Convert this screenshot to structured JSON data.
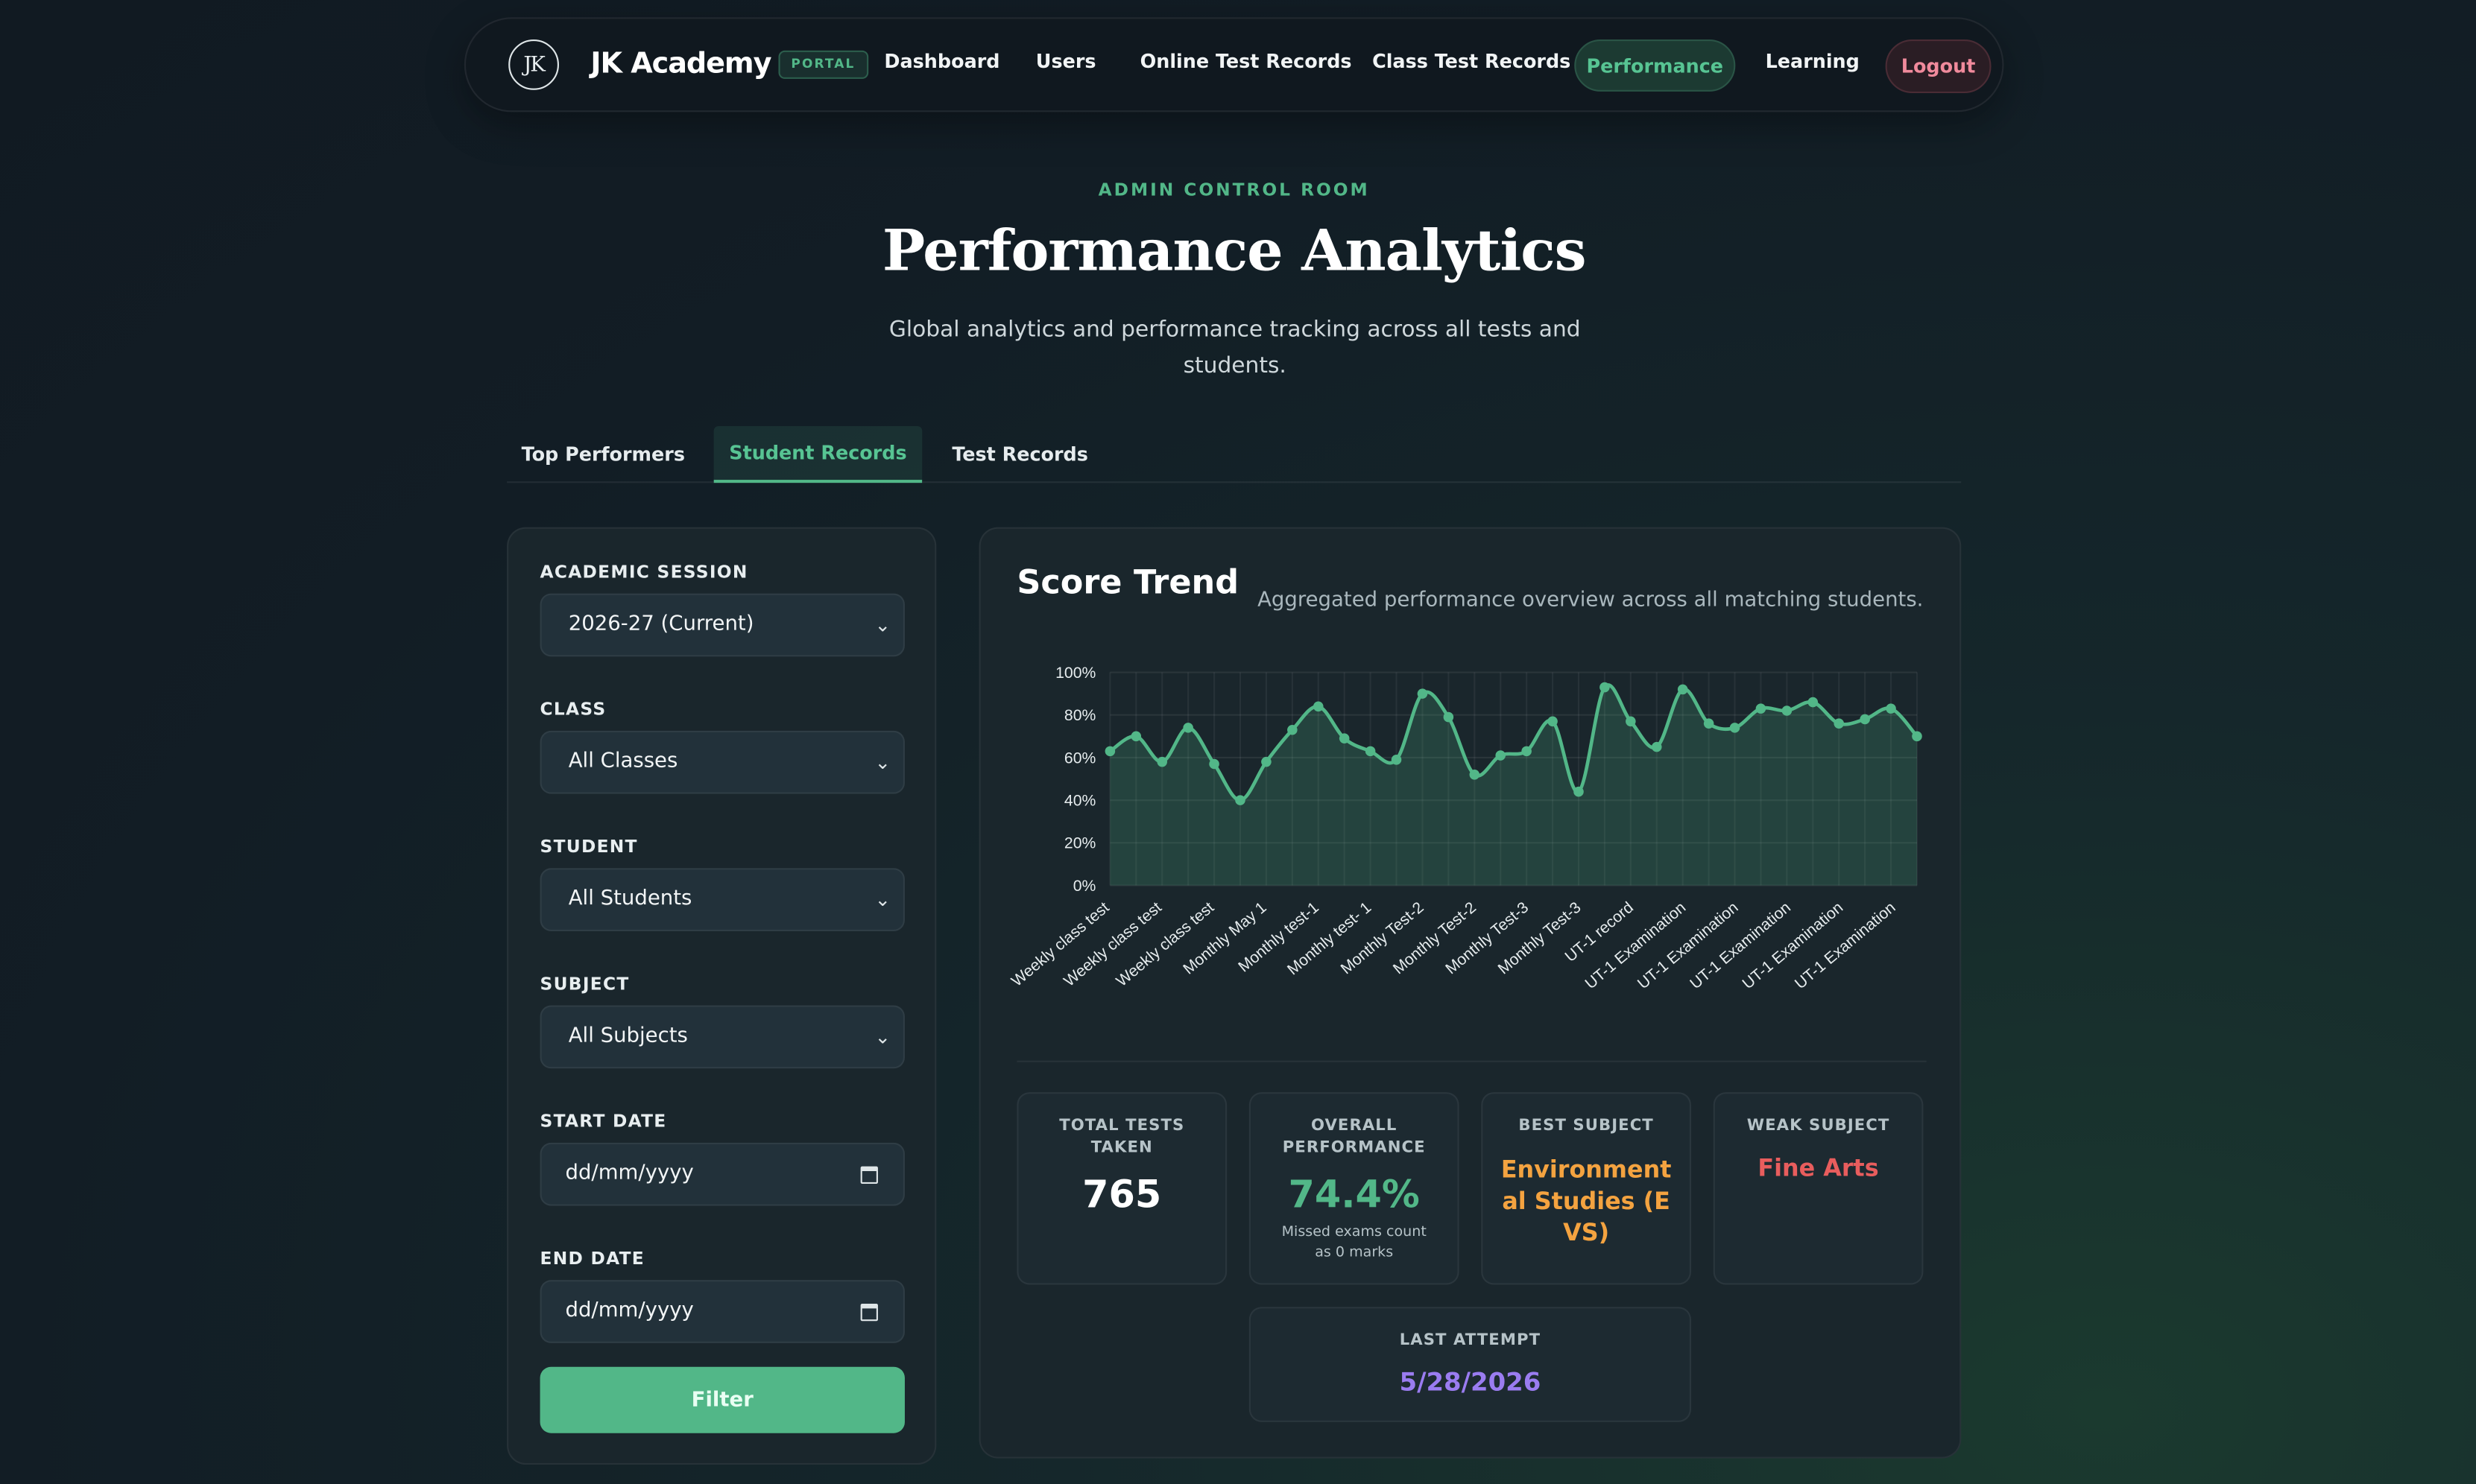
{
  "nav": {
    "logo_text": "JK",
    "brand": "JK Academy",
    "badge": "PORTAL",
    "links": [
      "Dashboard",
      "Users",
      "Online Test Records",
      "Class Test Records",
      "Performance",
      "Learning"
    ],
    "logout": "Logout"
  },
  "header": {
    "eyebrow": "ADMIN CONTROL ROOM",
    "title": "Performance Analytics",
    "subtitle": "Global analytics and performance tracking across all tests and students."
  },
  "tabs": [
    {
      "label": "Top Performers",
      "active": false
    },
    {
      "label": "Student Records",
      "active": true
    },
    {
      "label": "Test Records",
      "active": false
    }
  ],
  "filters": {
    "session": {
      "label": "ACADEMIC SESSION",
      "value": "2026-27 (Current)"
    },
    "class": {
      "label": "CLASS",
      "value": "All Classes"
    },
    "student": {
      "label": "STUDENT",
      "value": "All Students"
    },
    "subject": {
      "label": "SUBJECT",
      "value": "All Subjects"
    },
    "start_date": {
      "label": "START DATE",
      "placeholder": "dd/mm/yyyy"
    },
    "end_date": {
      "label": "END DATE",
      "placeholder": "dd/mm/yyyy"
    },
    "button": "Filter"
  },
  "score_trend": {
    "title": "Score Trend",
    "subtitle": "Aggregated performance overview across all matching students."
  },
  "stats": {
    "total_tests": {
      "label": "TOTAL TESTS TAKEN",
      "value": "765"
    },
    "overall": {
      "label": "OVERALL PERFORMANCE",
      "value": "74.4%",
      "note": "Missed exams count as 0 marks"
    },
    "best_subject": {
      "label": "BEST SUBJECT",
      "value": "Environmental Studies (EVS)"
    },
    "weak_subject": {
      "label": "WEAK SUBJECT",
      "value": "Fine Arts"
    },
    "last_attempt": {
      "label": "LAST ATTEMPT",
      "value": "5/28/2026"
    }
  },
  "colors": {
    "accent": "#52b788",
    "best": "#f4a340",
    "weak": "#e85d5d",
    "last_attempt": "#9a7cf0"
  },
  "chart_data": {
    "type": "area",
    "ylim": [
      0,
      100
    ],
    "y_ticks": [
      "0%",
      "20%",
      "40%",
      "60%",
      "80%",
      "100%"
    ],
    "x_tick_labels": [
      "Weekly class test",
      "Weekly class test",
      "Weekly class test",
      "Monthly May 1",
      "Monthly test-1",
      "Monthly test- 1",
      "Monthly Test-2",
      "Monthly Test-2",
      "Monthly Test-3",
      "Monthly Test-3",
      "UT-1 record",
      "UT-1 Examination",
      "UT-1 Examination",
      "UT-1 Examination",
      "UT-1 Examination",
      "UT-1 Examination"
    ],
    "values": [
      63,
      70,
      58,
      74,
      57,
      40,
      58,
      73,
      84,
      69,
      63,
      59,
      90,
      79,
      52,
      61,
      63,
      77,
      44,
      93,
      77,
      65,
      92,
      76,
      74,
      83,
      82,
      86,
      76,
      78,
      83,
      70
    ],
    "grid": true
  }
}
